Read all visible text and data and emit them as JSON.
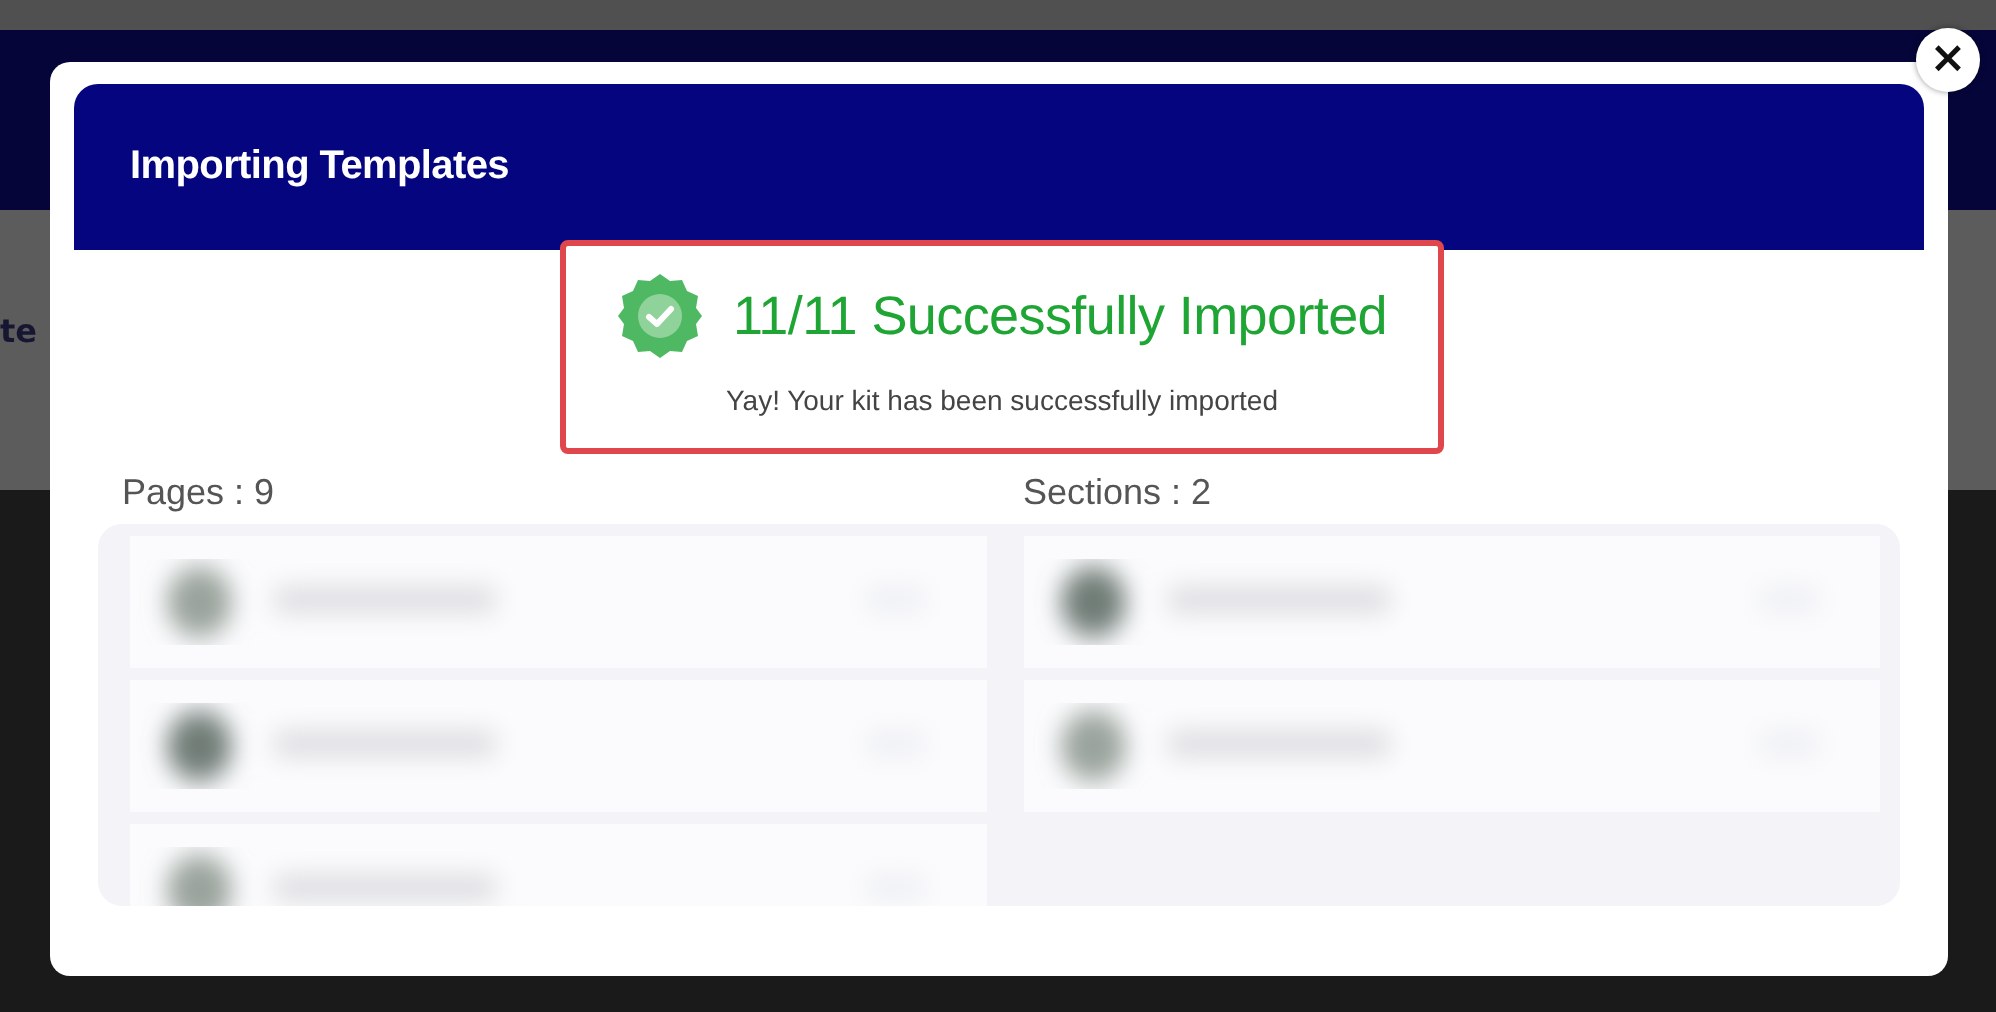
{
  "background": {
    "text": "te"
  },
  "dialog": {
    "title": "Importing Templates",
    "close": "×",
    "result": {
      "heading": "11/11 Successfully Imported",
      "message": "Yay! Your kit has been successfully imported"
    },
    "groups": [
      {
        "label": "Pages : 9"
      },
      {
        "label": "Sections : 2"
      }
    ]
  }
}
